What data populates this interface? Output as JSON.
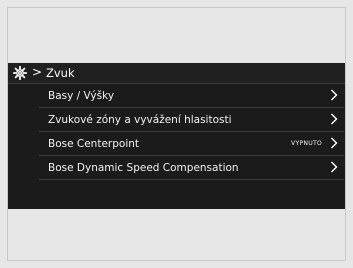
{
  "header": {
    "icon": "gear-icon",
    "separator": ">",
    "title": "Zvuk"
  },
  "menu": {
    "items": [
      {
        "label": "Basy / Výšky",
        "status": "",
        "icon": "chevron-right-icon"
      },
      {
        "label": "Zvukové zóny a vyvážení hlasitosti",
        "status": "",
        "icon": "chevron-right-icon"
      },
      {
        "label": "Bose Centerpoint",
        "status": "VYPNUTO",
        "icon": "chevron-right-icon"
      },
      {
        "label": "Bose Dynamic Speed Compensation",
        "status": "",
        "icon": "chevron-right-icon"
      }
    ]
  },
  "colors": {
    "screen_bg": "#1b1b1b",
    "text": "#ffffff",
    "divider": "#3a3a3a",
    "page_bg": "#e6e6e6"
  }
}
